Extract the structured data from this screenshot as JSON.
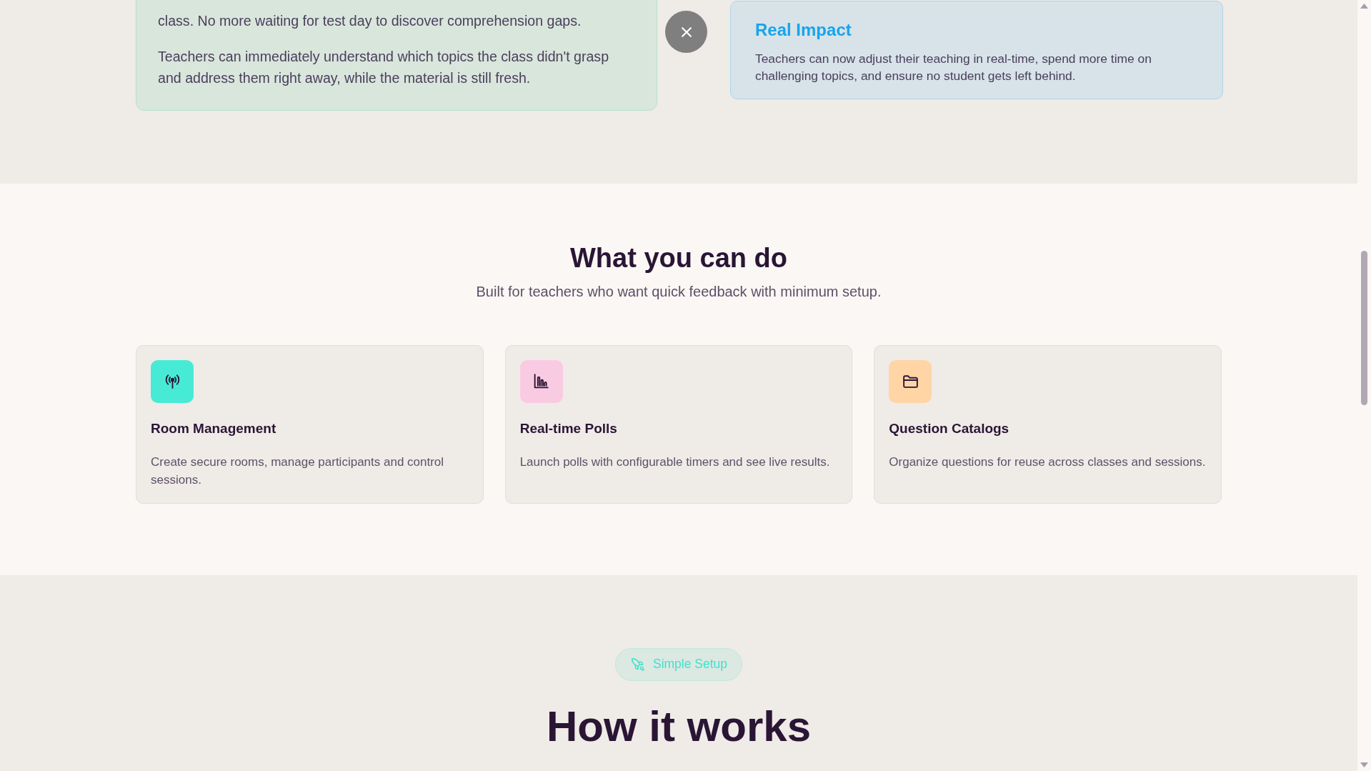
{
  "impact_section": {
    "problem_card": {
      "paragraphs": [
        "class. No more waiting for test day to discover comprehension gaps.",
        "Teachers can immediately understand which topics the class didn't grasp and address them right away, while the material is still fresh."
      ]
    },
    "impact_card": {
      "title": "Real Impact",
      "text": "Teachers can now adjust their teaching in real-time, spend more time on challenging topics, and ensure no student gets left behind."
    }
  },
  "features_section": {
    "title": "What you can do",
    "subtitle": "Built for teachers who want quick feedback with minimum setup.",
    "features": [
      {
        "kind": "antenna",
        "color": "#47ebd5",
        "title": "Room Management",
        "description": "Create secure rooms, manage participants and control sessions."
      },
      {
        "kind": "chart",
        "color": "#f9cbe3",
        "title": "Real-time Polls",
        "description": "Launch polls with configurable timers and see live results."
      },
      {
        "kind": "folder",
        "color": "#ffd5a6",
        "title": "Question Catalogs",
        "description": "Organize questions for reuse across classes and sessions."
      }
    ]
  },
  "how_it_works_section": {
    "badge": "Simple Setup",
    "title": "How it works"
  }
}
